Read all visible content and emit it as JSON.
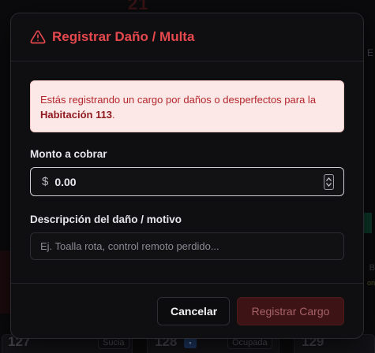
{
  "background": {
    "top_number": "21",
    "right_fragment": "e E",
    "rooms": [
      {
        "number": "127",
        "status": "Sucia"
      },
      {
        "number": "128",
        "status": "Ocupada"
      },
      {
        "number": "129",
        "status": ""
      }
    ],
    "fragment_b": "B",
    "fragment_n": "on"
  },
  "modal": {
    "title": "Registrar Daño / Multa",
    "alert": {
      "text": "Estás registrando un cargo por daños o desperfectos para la",
      "room": "Habitación 113",
      "suffix": "."
    },
    "amount": {
      "label": "Monto a cobrar",
      "currency": "$",
      "value": "0.00"
    },
    "description": {
      "label": "Descripción del daño / motivo",
      "placeholder": "Ej. Toalla rota, control remoto perdido..."
    },
    "buttons": {
      "cancel": "Cancelar",
      "submit": "Registrar Cargo"
    }
  },
  "colors": {
    "accent": "#e5484d",
    "alert_bg": "#fde8e8",
    "submit_bg": "#3d1316"
  }
}
